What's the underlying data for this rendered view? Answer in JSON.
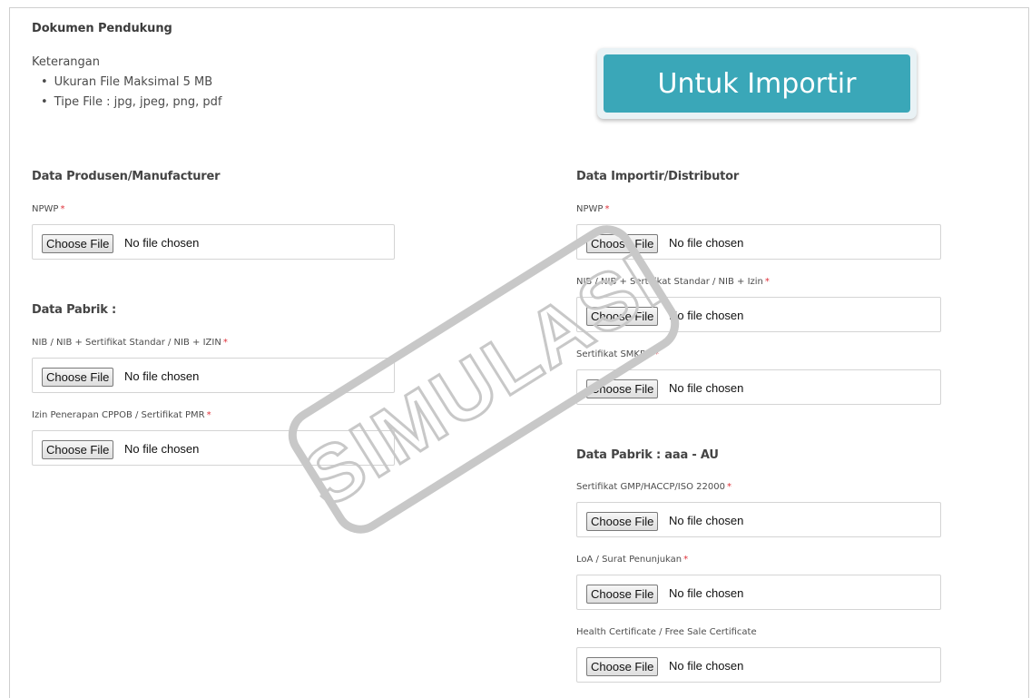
{
  "header": {
    "title": "Dokumen Pendukung",
    "note_title": "Keterangan",
    "notes": [
      "Ukuran File Maksimal 5 MB",
      "Tipe File : jpg, jpeg, png, pdf"
    ]
  },
  "banner": {
    "text": "Untuk Importir"
  },
  "watermark": {
    "text": "SIMULASI"
  },
  "file_input": {
    "button_label": "Choose File",
    "status": "No file chosen"
  },
  "required_mark": "*",
  "left": {
    "title": "Data Produsen/Manufacturer",
    "npwp_label": "NPWP",
    "pabrik_title": "Data Pabrik :",
    "nib_label": "NIB / NIB + Sertifikat Standar / NIB + IZIN",
    "izin_label": "Izin Penerapan CPPOB / Sertifikat PMR"
  },
  "right": {
    "title": "Data Importir/Distributor",
    "npwp_label": "NPWP",
    "nib_label": "NIB / NIB + Sertifikat Standar / NIB + Izin",
    "smkpo_label": "Sertifikat SMKPO",
    "pabrik_title": "Data Pabrik : aaa - AU",
    "gmp_label": "Sertifikat GMP/HACCP/ISO 22000",
    "loa_label": "LoA / Surat Penunjukan",
    "health_label": "Health Certificate / Free Sale Certificate"
  },
  "colors": {
    "banner_bg": "#3aa7b8",
    "required": "#e0313a",
    "watermark": "#c8c8c8"
  }
}
